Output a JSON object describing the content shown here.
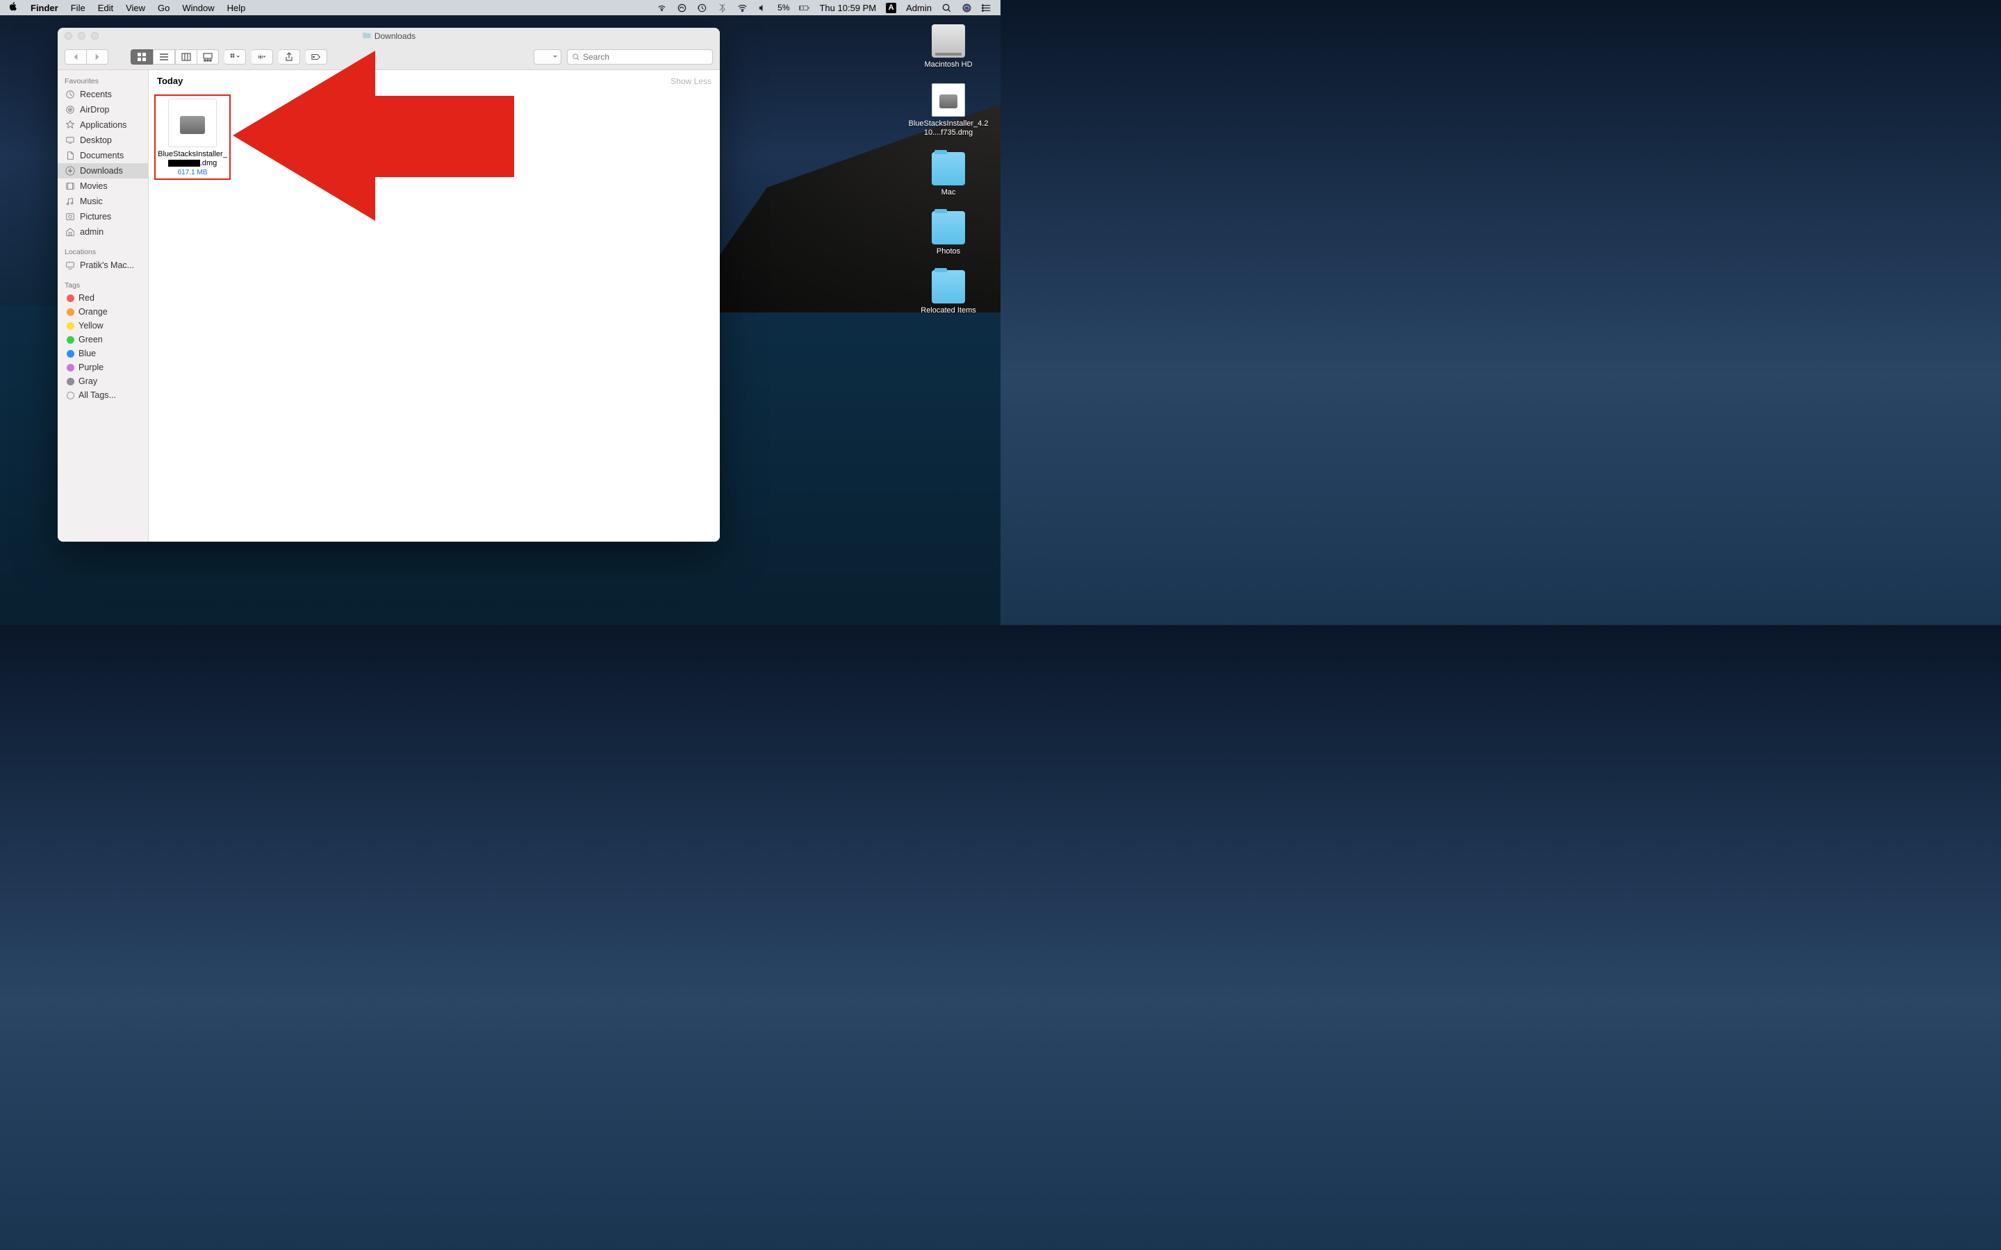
{
  "menubar": {
    "app_name": "Finder",
    "items": [
      "File",
      "Edit",
      "View",
      "Go",
      "Window",
      "Help"
    ],
    "battery": "5%",
    "clock": "Thu 10:59 PM",
    "user": "Admin"
  },
  "desktop_icons": [
    {
      "type": "hd",
      "label": "Macintosh HD"
    },
    {
      "type": "dmg",
      "label": "BlueStacksInstaller_4.210....f735.dmg"
    },
    {
      "type": "folder",
      "label": "Mac"
    },
    {
      "type": "folder",
      "label": "Photos"
    },
    {
      "type": "folder",
      "label": "Relocated Items"
    }
  ],
  "finder": {
    "title": "Downloads",
    "search_placeholder": "Search",
    "sidebar": {
      "favourites_header": "Favourites",
      "favourites": [
        {
          "icon": "clock",
          "label": "Recents"
        },
        {
          "icon": "airdrop",
          "label": "AirDrop"
        },
        {
          "icon": "apps",
          "label": "Applications"
        },
        {
          "icon": "desktop",
          "label": "Desktop"
        },
        {
          "icon": "doc",
          "label": "Documents"
        },
        {
          "icon": "downloads",
          "label": "Downloads",
          "selected": true
        },
        {
          "icon": "movies",
          "label": "Movies"
        },
        {
          "icon": "music",
          "label": "Music"
        },
        {
          "icon": "pictures",
          "label": "Pictures"
        },
        {
          "icon": "house",
          "label": "admin"
        }
      ],
      "locations_header": "Locations",
      "locations": [
        {
          "icon": "display",
          "label": "Pratik's Mac..."
        }
      ],
      "tags_header": "Tags",
      "tags": [
        {
          "color": "#ff5b56",
          "label": "Red"
        },
        {
          "color": "#ff9f2e",
          "label": "Orange"
        },
        {
          "color": "#ffde3c",
          "label": "Yellow"
        },
        {
          "color": "#39cf4c",
          "label": "Green"
        },
        {
          "color": "#2a8cff",
          "label": "Blue"
        },
        {
          "color": "#c978da",
          "label": "Purple"
        },
        {
          "color": "#8e8e8e",
          "label": "Gray"
        }
      ],
      "all_tags_label": "All Tags..."
    },
    "content": {
      "section_title": "Today",
      "show_less": "Show Less",
      "files": [
        {
          "name_pre": "BlueStacksInstaller_",
          "ext": ".dmg",
          "size": "617.1 MB"
        }
      ]
    }
  }
}
